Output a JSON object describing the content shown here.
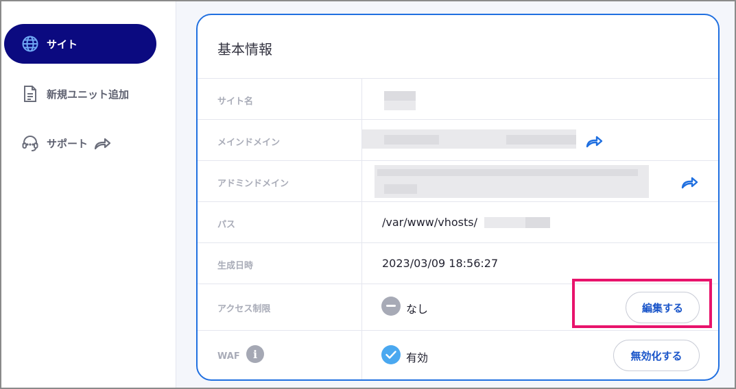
{
  "sidebar": {
    "items": [
      {
        "label": "サイト",
        "icon": "globe-icon",
        "active": true
      },
      {
        "label": "新規ユニット追加",
        "icon": "document-icon",
        "active": false
      },
      {
        "label": "サポート",
        "icon": "headset-icon",
        "active": false,
        "external": true
      }
    ]
  },
  "card": {
    "title": "基本情報",
    "rows": {
      "site_name": {
        "label": "サイト名"
      },
      "main_domain": {
        "label": "メインドメイン"
      },
      "admin_domain": {
        "label": "アドミンドメイン"
      },
      "path": {
        "label": "パス",
        "value": "/var/www/vhosts/"
      },
      "created_at": {
        "label": "生成日時",
        "value": "2023/03/09 18:56:27"
      },
      "access_restriction": {
        "label": "アクセス制限",
        "status": "なし",
        "button": "編集する"
      },
      "waf": {
        "label": "WAF",
        "info_glyph": "i",
        "status": "有効",
        "button": "無効化する"
      }
    }
  },
  "colors": {
    "nav_active": "#0b0a80",
    "card_border": "#1f6fe0",
    "link": "#1a55c9",
    "highlight": "#e8136b",
    "check": "#4aa8f0"
  }
}
